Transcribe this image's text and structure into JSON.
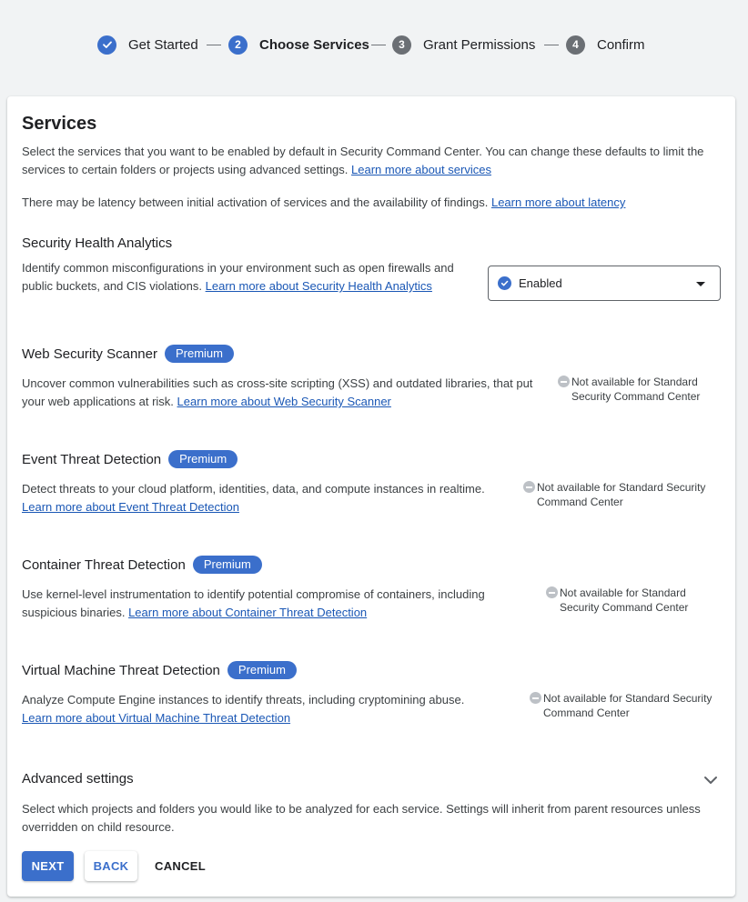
{
  "stepper": {
    "steps": [
      {
        "number": "",
        "label": "Get Started",
        "state": "done"
      },
      {
        "number": "2",
        "label": "Choose Services",
        "state": "active"
      },
      {
        "number": "3",
        "label": "Grant Permissions",
        "state": "todo"
      },
      {
        "number": "4",
        "label": "Confirm",
        "state": "todo"
      }
    ]
  },
  "services": {
    "title": "Services",
    "intro_text": "Select the services that you want to be enabled by default in Security Command Center. You can change these defaults to limit the services to certain folders or projects using advanced settings.",
    "intro_link": "Learn more about services",
    "latency_text": "There may be latency between initial activation of services and the availability of findings.",
    "latency_link": "Learn more about latency"
  },
  "sha": {
    "title": "Security Health Analytics",
    "desc_line1": "Identify common misconfigurations in your environment such as open firewalls and",
    "desc_line2": "public buckets, and CIS violations.",
    "link": "Learn more about Security Health Analytics",
    "select_value": "Enabled"
  },
  "wss": {
    "title": "Web Security Scanner",
    "badge": "Premium",
    "desc_line1": "Uncover common vulnerabilities such as cross-site scripting (XSS) and outdated libraries, that put",
    "desc_line2": "your web applications at risk.",
    "link": "Learn more about Web Security Scanner",
    "na_line1": "Not available for Standard",
    "na_line2": "Security Command Center"
  },
  "etd": {
    "title": "Event Threat Detection",
    "badge": "Premium",
    "desc_line1": "Detect threats to your cloud platform, identities, data, and compute instances in realtime.",
    "link": "Learn more about Event Threat Detection",
    "na_line1": "Not available for Standard Security",
    "na_line2": "Command Center"
  },
  "ctd": {
    "title": "Container Threat Detection",
    "badge": "Premium",
    "desc_line1": "Use kernel-level instrumentation to identify potential compromise of containers, including",
    "desc_line2": "suspicious binaries.",
    "link": "Learn more about Container Threat Detection",
    "na_line1": "Not available for Standard",
    "na_line2": "Security Command Center"
  },
  "vmtd": {
    "title": "Virtual Machine Threat Detection",
    "badge": "Premium",
    "desc_line1": "Analyze Compute Engine instances to identify threats, including cryptomining abuse.",
    "link": "Learn more about Virtual Machine Threat Detection",
    "na_line1": "Not available for Standard Security",
    "na_line2": "Command Center"
  },
  "advanced": {
    "title": "Advanced settings",
    "desc_line1": "Select which projects and folders you would like to be analyzed for each service. Settings will inherit from parent resources unless",
    "desc_line2": "overridden on child resource."
  },
  "actions": {
    "next": "NEXT",
    "back": "BACK",
    "cancel": "CANCEL"
  },
  "colors": {
    "accent": "#3b6fcb",
    "link": "#1a57b5"
  },
  "icons": {
    "done_step": "check-circle-icon",
    "select_status": "check-circle-icon",
    "unavailable": "minus-circle-icon",
    "dropdown": "caret-down-icon",
    "expand": "chevron-down-icon"
  }
}
